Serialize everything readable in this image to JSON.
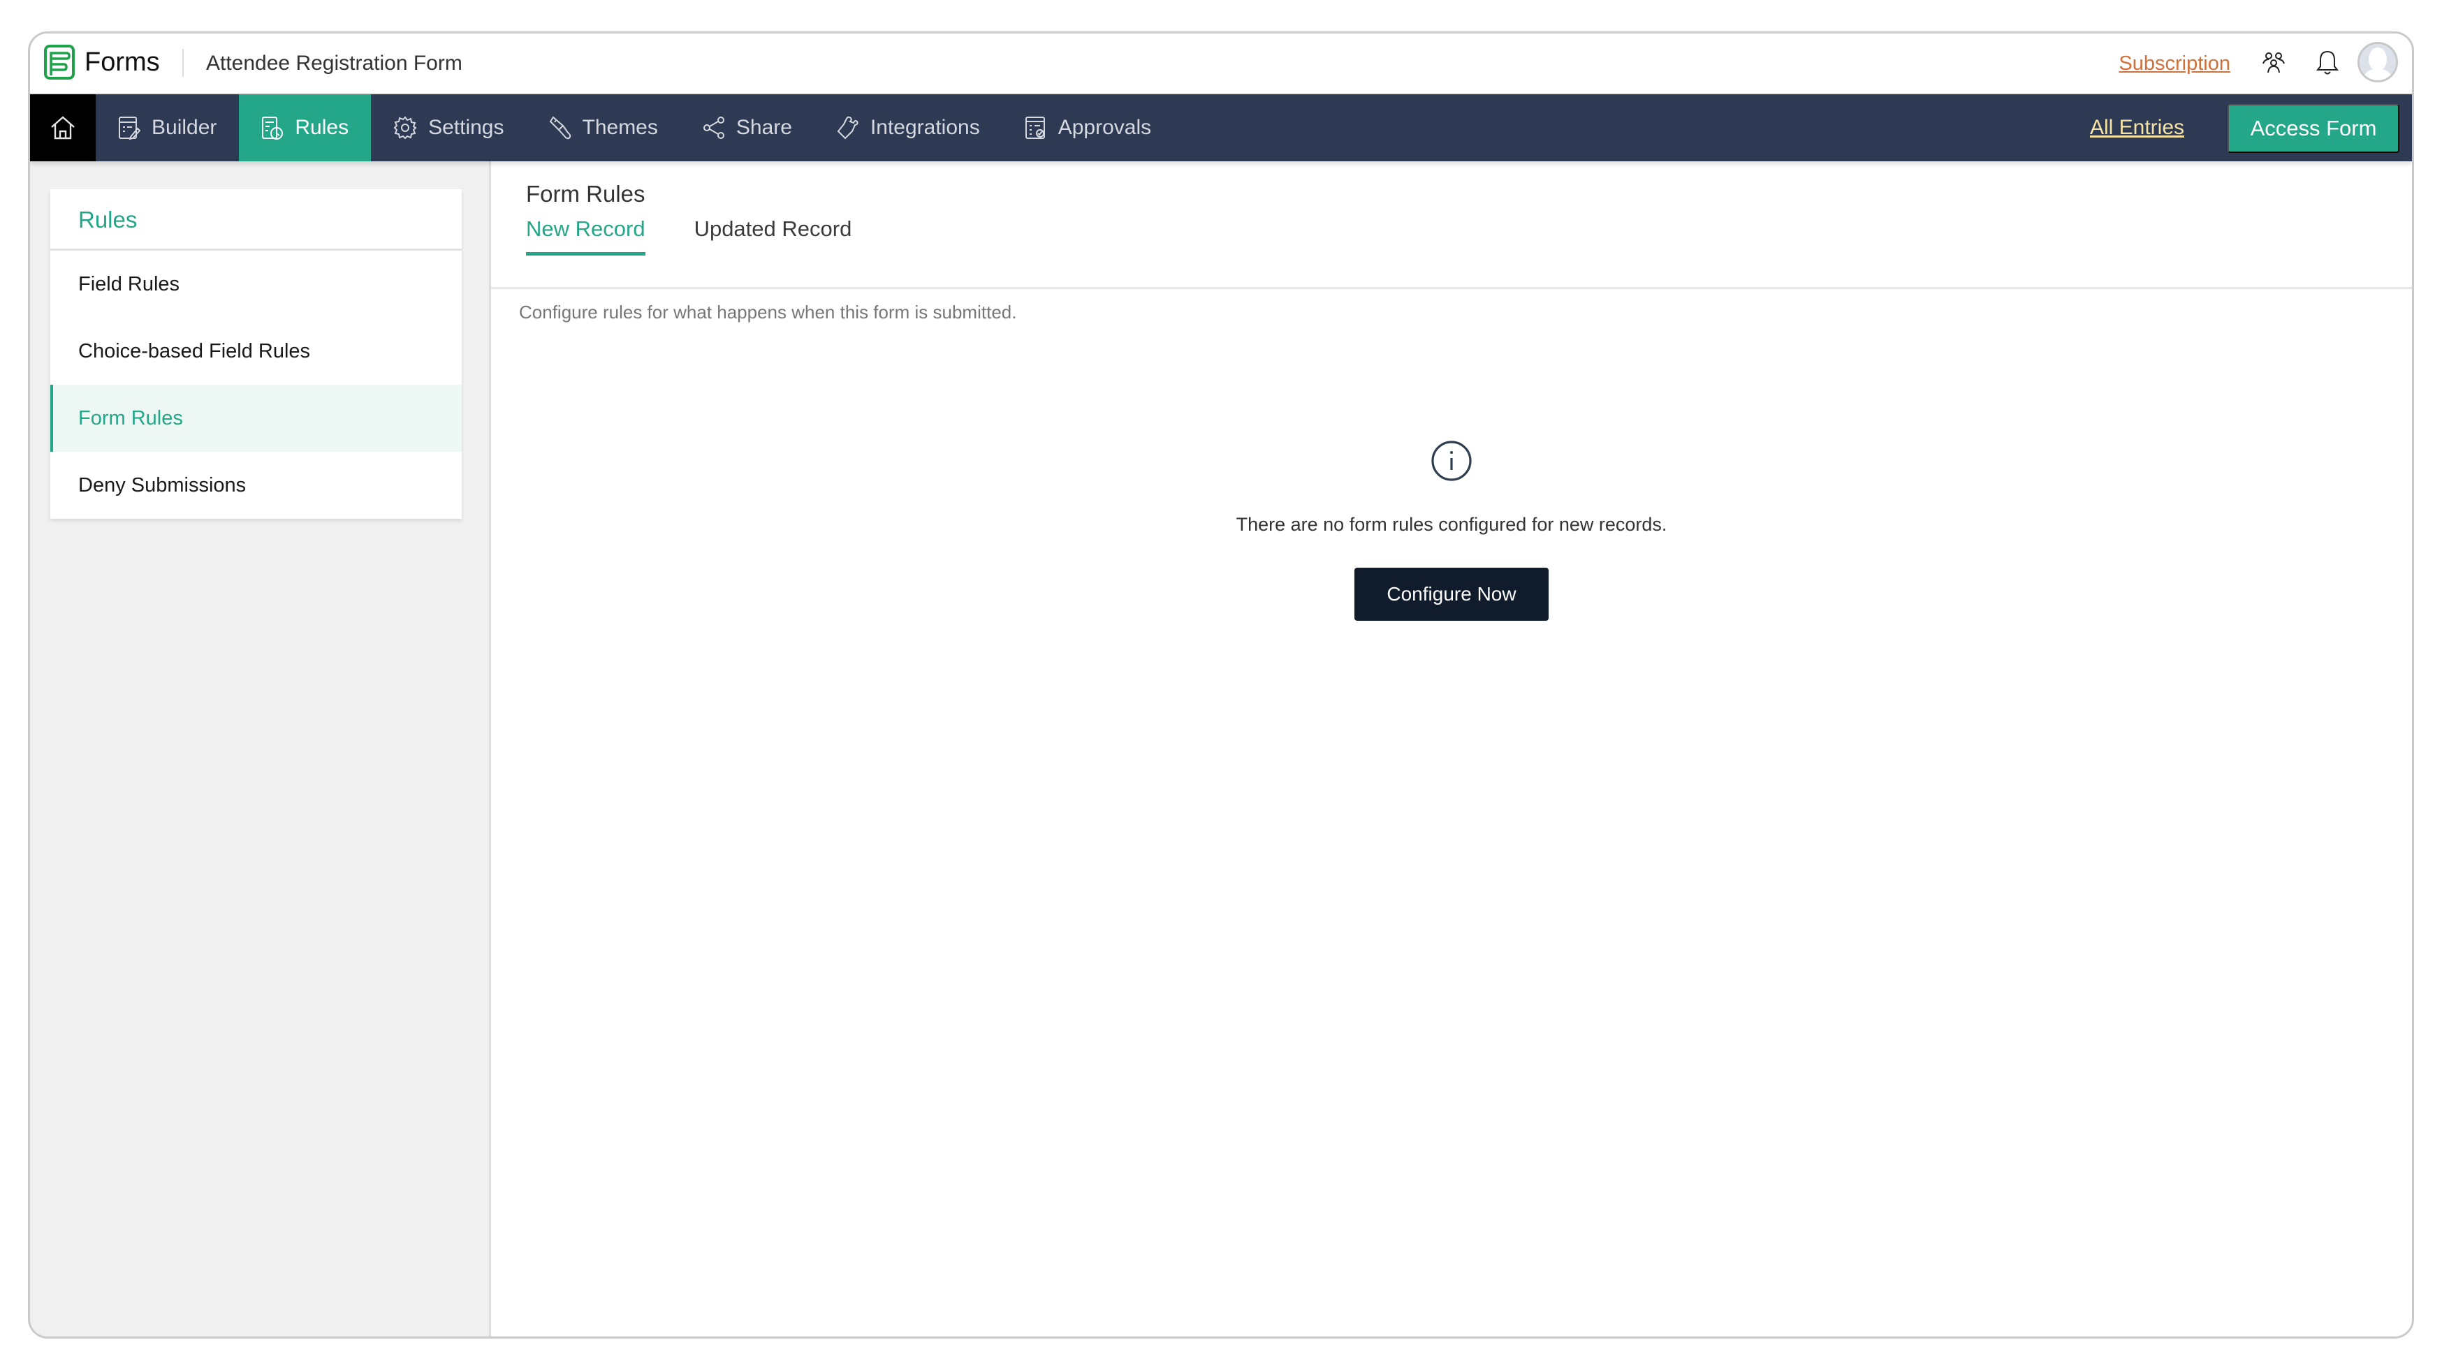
{
  "header": {
    "brand": "Forms",
    "form_name": "Attendee Registration Form",
    "subscription_label": "Subscription",
    "icons": [
      "users-icon",
      "bell-icon",
      "avatar"
    ]
  },
  "nav": {
    "home_icon": "home-icon",
    "items": [
      {
        "label": "Builder",
        "icon": "builder-icon",
        "active": false
      },
      {
        "label": "Rules",
        "icon": "rules-icon",
        "active": true
      },
      {
        "label": "Settings",
        "icon": "gear-icon",
        "active": false
      },
      {
        "label": "Themes",
        "icon": "paintbrush-icon",
        "active": false
      },
      {
        "label": "Share",
        "icon": "share-icon",
        "active": false
      },
      {
        "label": "Integrations",
        "icon": "puzzle-icon",
        "active": false
      },
      {
        "label": "Approvals",
        "icon": "approvals-icon",
        "active": false
      }
    ],
    "all_entries_label": "All Entries",
    "access_form_label": "Access Form"
  },
  "sidebar": {
    "title": "Rules",
    "items": [
      {
        "label": "Field Rules",
        "active": false
      },
      {
        "label": "Choice-based Field Rules",
        "active": false
      },
      {
        "label": "Form Rules",
        "active": true
      },
      {
        "label": "Deny Submissions",
        "active": false
      }
    ]
  },
  "main": {
    "title": "Form Rules",
    "tabs": [
      {
        "label": "New Record",
        "active": true
      },
      {
        "label": "Updated Record",
        "active": false
      }
    ],
    "description": "Configure rules for what happens when this form is submitted.",
    "empty_state": {
      "icon": "info-icon",
      "message": "There are no form rules configured for new records.",
      "button_label": "Configure Now"
    }
  },
  "colors": {
    "accent": "#24a688",
    "nav_bg": "#2e3a53",
    "subscription": "#d0703a",
    "all_entries": "#f5e3a5",
    "primary_button": "#101b2b"
  }
}
